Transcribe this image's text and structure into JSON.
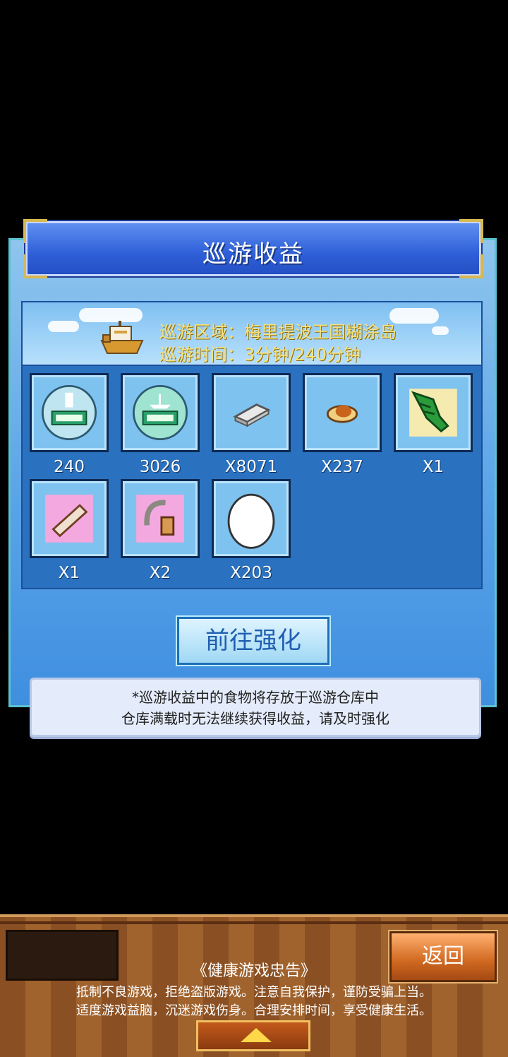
{
  "dialog": {
    "title": "巡游收益",
    "area_line": "巡游区域：梅里提波王国糊涂岛",
    "time_line": "巡游时间：3分钟/240分钟",
    "items": [
      {
        "icon": "staff-exp-ticket-icon",
        "qty": "240"
      },
      {
        "icon": "ship-exp-ticket-icon",
        "qty": "3026"
      },
      {
        "icon": "silver-bar-icon",
        "qty": "X8071"
      },
      {
        "icon": "roast-chicken-icon",
        "qty": "X237"
      },
      {
        "icon": "green-leaves-icon",
        "qty": "X1"
      },
      {
        "icon": "bread-roll-icon",
        "qty": "X1"
      },
      {
        "icon": "fishing-tool-icon",
        "qty": "X2"
      },
      {
        "icon": "egg-icon",
        "qty": "X203"
      }
    ],
    "go_button": "前往强化",
    "note_line1": "*巡游收益中的食物将存放于巡游仓库中",
    "note_line2": "仓库满载时无法继续获得收益，请及时强化"
  },
  "bottom": {
    "back_button": "返回",
    "advice_title": "《健康游戏忠告》",
    "advice_line1": "抵制不良游戏，拒绝盗版游戏。注意自我保护，谨防受骗上当。",
    "advice_line2": "适度游戏益脑，沉迷游戏伤身。合理安排时间，享受健康生活。"
  }
}
